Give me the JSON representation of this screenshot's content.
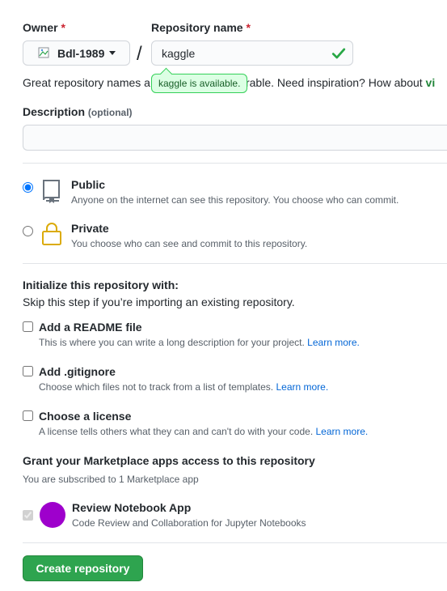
{
  "owner": {
    "label": "Owner",
    "required_mark": "*",
    "selected": "Bdl-1989"
  },
  "repo": {
    "label": "Repository name",
    "required_mark": "*",
    "value": "kaggle",
    "separator": "/",
    "availability_tooltip": "kaggle is available."
  },
  "hint": {
    "prefix": "Great repository names a",
    "middle": "rable. Need inspiration? How about ",
    "suggestion": "vi"
  },
  "description": {
    "label": "Description",
    "optional_label": "(optional)",
    "value": ""
  },
  "visibility": {
    "public": {
      "title": "Public",
      "note": "Anyone on the internet can see this repository. You choose who can commit.",
      "checked": true
    },
    "private": {
      "title": "Private",
      "note": "You choose who can see and commit to this repository.",
      "checked": false
    }
  },
  "init": {
    "title": "Initialize this repository with:",
    "subtitle": "Skip this step if you’re importing an existing repository.",
    "readme": {
      "title": "Add a README file",
      "note": "This is where you can write a long description for your project.",
      "link": "Learn more."
    },
    "gitignore": {
      "title": "Add .gitignore",
      "note": "Choose which files not to track from a list of templates.",
      "link": "Learn more."
    },
    "license": {
      "title": "Choose a license",
      "note": "A license tells others what they can and can't do with your code.",
      "link": "Learn more."
    }
  },
  "marketplace": {
    "title": "Grant your Marketplace apps access to this repository",
    "subtitle": "You are subscribed to 1 Marketplace app",
    "app": {
      "name": "Review Notebook App",
      "description": "Code Review and Collaboration for Jupyter Notebooks",
      "checked": true,
      "avatar_color": "#9e00cc"
    }
  },
  "create_button": {
    "label": "Create repository",
    "color": "#2ea44f"
  },
  "colors": {
    "required": "#cb2431",
    "link": "#0366d6",
    "success": "#28a745",
    "tooltip_bg": "#dcffe4"
  }
}
